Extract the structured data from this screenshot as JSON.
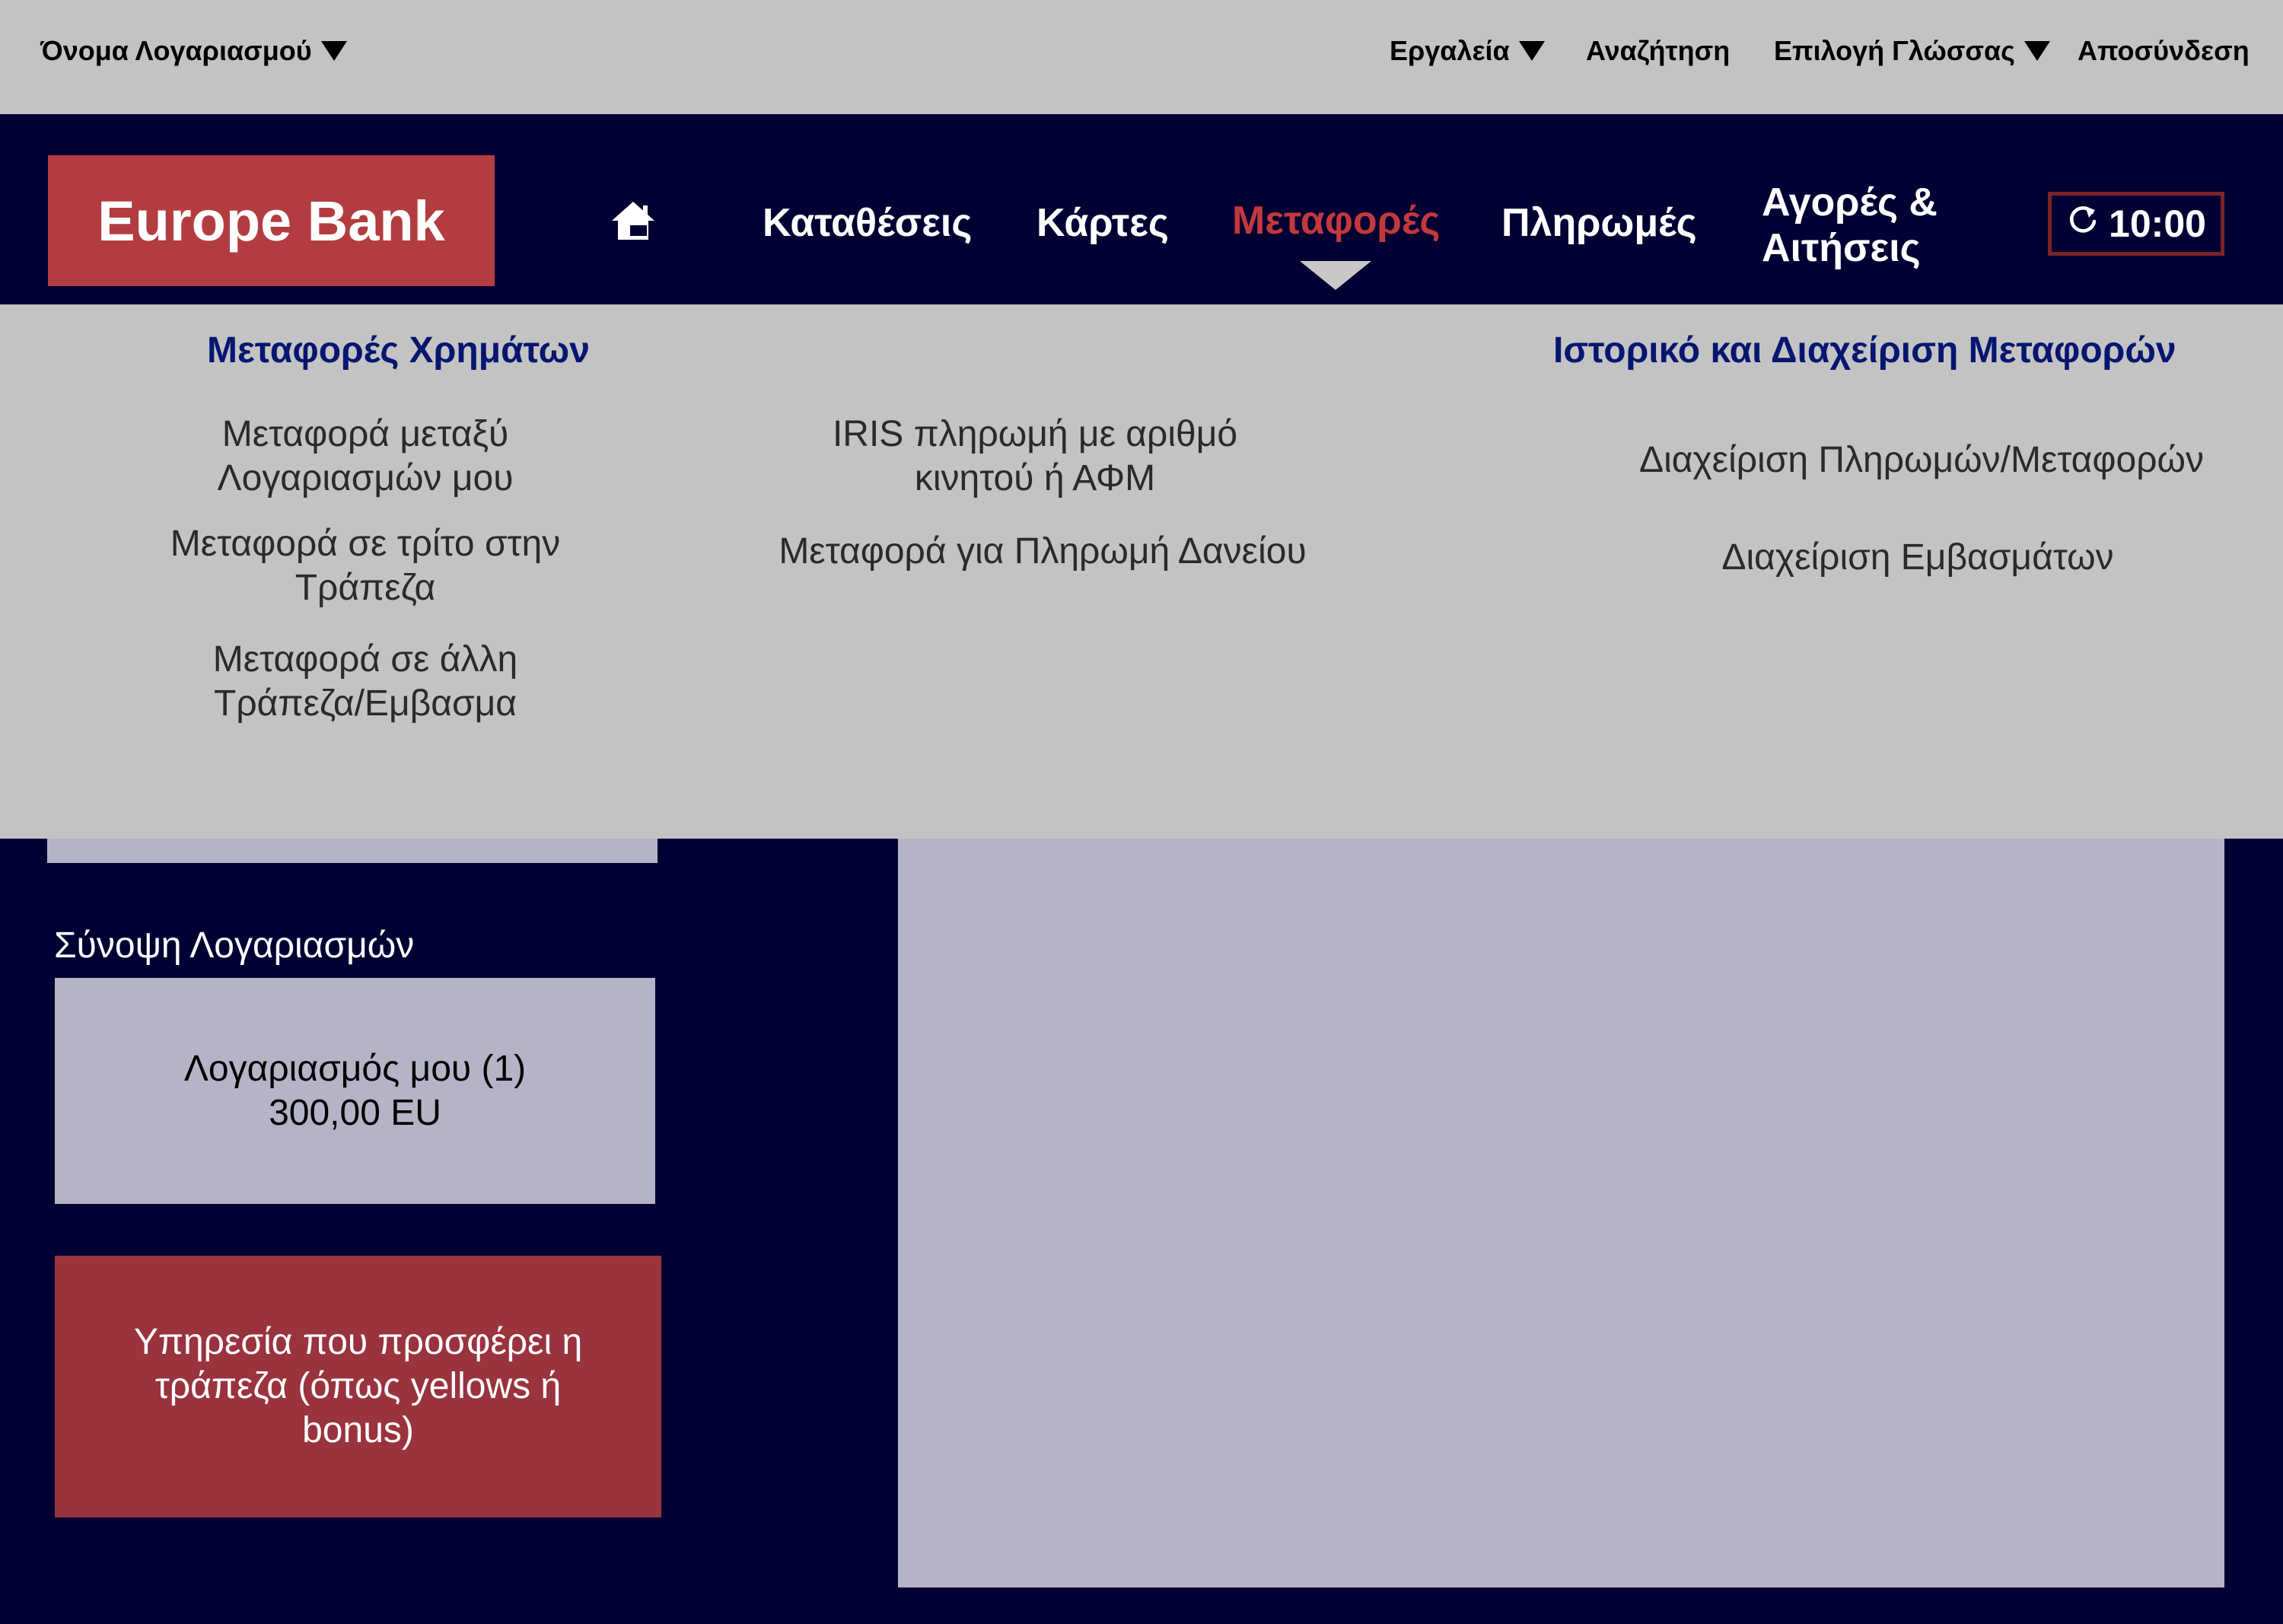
{
  "utility_bar": {
    "account_name": "Όνομα Λογαριασμού",
    "tools": "Εργαλεία",
    "search": "Αναζήτηση",
    "language": "Επιλογή Γλώσσας",
    "logout": "Αποσύνδεση"
  },
  "brand": {
    "name": "Europe Bank",
    "color": "#b33c40"
  },
  "nav": {
    "home_icon": "home-icon",
    "deposits": "Καταθέσεις",
    "cards": "Κάρτες",
    "transfers": "Μεταφορές",
    "payments": "Πληρωμές",
    "purchases": "Αγορές & Αιτήσεις",
    "active_color": "#c2393c"
  },
  "session": {
    "icon": "refresh-icon",
    "time": "10:00"
  },
  "dropdown": {
    "col1": {
      "heading": "Μεταφορές Χρημάτων",
      "links": [
        "Μεταφορά μεταξύ Λογαριασμών μου",
        "Μεταφορά σε τρίτο στην Τράπεζα",
        "Μεταφορά σε άλλη Τράπεζα/Εμβασμα"
      ]
    },
    "col2": {
      "links": [
        "IRIS πληρωμή με αριθμό κινητού ή ΑΦΜ",
        "Μεταφορά για Πληρωμή Δανείου"
      ]
    },
    "col3": {
      "heading": "Ιστορικό και Διαχείριση Μεταφορών",
      "links": [
        "Διαχείριση Πληρωμών/Μεταφορών",
        "Διαχείριση Εμβασμάτων"
      ]
    }
  },
  "sidebar": {
    "summary_title": "Σύνοψη Λογαριασμών",
    "account_label": "Λογαριασμός μου (1)",
    "account_balance": "300,00 EU",
    "promo_text": "Υπηρεσία που προσφέρει η τράπεζα (όπως yellows ή bonus)"
  }
}
